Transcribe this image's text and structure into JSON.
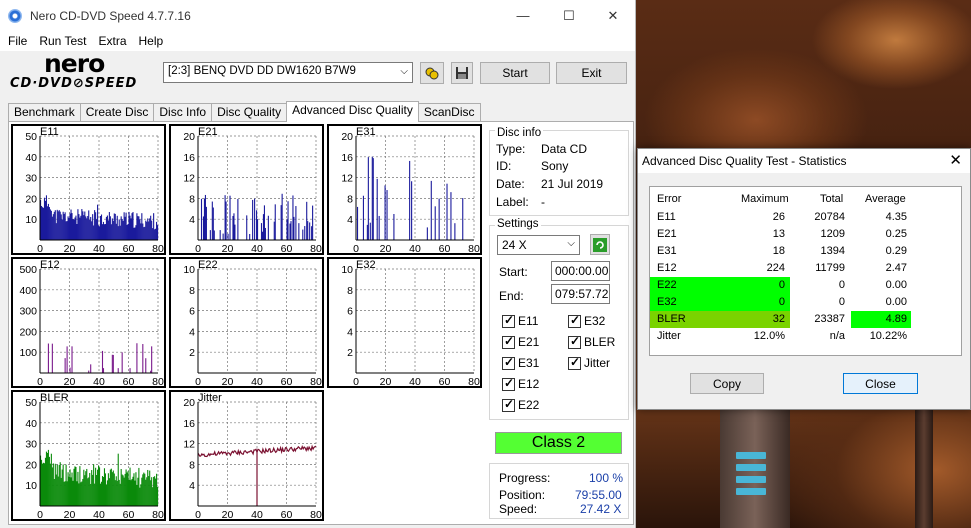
{
  "window": {
    "title": "Nero CD-DVD Speed 4.7.7.16",
    "minimize": "—",
    "maximize": "☐",
    "close": "✕"
  },
  "menu": [
    "File",
    "Run Test",
    "Extra",
    "Help"
  ],
  "logo": {
    "nero": "nero",
    "cddvd": "CD·DVD⊘SPEED"
  },
  "toolbar": {
    "drive": "[2:3]  BENQ DVD DD DW1620 B7W9",
    "start": "Start",
    "exit": "Exit",
    "drive_icon": "drive-swap-icon",
    "save_icon": "floppy-disk-icon"
  },
  "tabs": [
    "Benchmark",
    "Create Disc",
    "Disc Info",
    "Disc Quality",
    "Advanced Disc Quality",
    "ScanDisc"
  ],
  "active_tab": 4,
  "disc_info": {
    "title": "Disc info",
    "type_label": "Type:",
    "type": "Data CD",
    "id_label": "ID:",
    "id": "Sony",
    "date_label": "Date:",
    "date": "21 Jul 2019",
    "label_label": "Label:",
    "label": "-"
  },
  "settings": {
    "title": "Settings",
    "speed": "24 X",
    "start_label": "Start:",
    "start": "000:00.00",
    "end_label": "End:",
    "end": "079:57.72",
    "checks": {
      "e11": "E11",
      "e32": "E32",
      "e21": "E21",
      "bler": "BLER",
      "e31": "E31",
      "jitter": "Jitter",
      "e12": "E12",
      "e22": "E22"
    }
  },
  "class_label": "Class 2",
  "progress": {
    "progress_label": "Progress:",
    "progress": "100 %",
    "position_label": "Position:",
    "position": "79:55.00",
    "speed_label": "Speed:",
    "speed": "27.42 X"
  },
  "chart_data": [
    {
      "type": "bar",
      "title": "E11",
      "xlim": [
        0,
        80
      ],
      "ylim": [
        0,
        50
      ],
      "yticks": [
        10,
        20,
        30,
        40,
        50
      ],
      "xticks": [
        0,
        20,
        40,
        60,
        80
      ],
      "color": "#1a1a9c",
      "max": 26,
      "profile": "e11"
    },
    {
      "type": "bar",
      "title": "E21",
      "xlim": [
        0,
        80
      ],
      "ylim": [
        0,
        20
      ],
      "yticks": [
        4,
        8,
        12,
        16,
        20
      ],
      "xticks": [
        0,
        20,
        40,
        60,
        80
      ],
      "color": "#1a1a9c",
      "max": 13,
      "profile": "e21"
    },
    {
      "type": "bar",
      "title": "E31",
      "xlim": [
        0,
        80
      ],
      "ylim": [
        0,
        20
      ],
      "yticks": [
        4,
        8,
        12,
        16,
        20
      ],
      "xticks": [
        0,
        20,
        40,
        60,
        80
      ],
      "color": "#1a1a9c",
      "max": 18,
      "profile": "e31"
    },
    {
      "type": "bar",
      "title": "E12",
      "xlim": [
        0,
        80
      ],
      "ylim": [
        0,
        500
      ],
      "yticks": [
        100,
        200,
        300,
        400,
        500
      ],
      "xticks": [
        0,
        20,
        40,
        60,
        80
      ],
      "color": "#7a1a8c",
      "max": 224,
      "profile": "e12"
    },
    {
      "type": "bar",
      "title": "E22",
      "xlim": [
        0,
        80
      ],
      "ylim": [
        0,
        10
      ],
      "yticks": [
        2,
        4,
        6,
        8,
        10
      ],
      "xticks": [
        0,
        20,
        40,
        60,
        80
      ],
      "color": "#1a1a9c",
      "max": 0,
      "profile": "zero"
    },
    {
      "type": "bar",
      "title": "E32",
      "xlim": [
        0,
        80
      ],
      "ylim": [
        0,
        10
      ],
      "yticks": [
        2,
        4,
        6,
        8,
        10
      ],
      "xticks": [
        0,
        20,
        40,
        60,
        80
      ],
      "color": "#1a1a9c",
      "max": 0,
      "profile": "zero"
    },
    {
      "type": "bar",
      "title": "BLER",
      "xlim": [
        0,
        80
      ],
      "ylim": [
        0,
        50
      ],
      "yticks": [
        10,
        20,
        30,
        40,
        50
      ],
      "xticks": [
        0,
        20,
        40,
        60,
        80
      ],
      "color": "#0a8a0a",
      "max": 32,
      "profile": "bler"
    },
    {
      "type": "line",
      "title": "Jitter",
      "xlim": [
        0,
        80
      ],
      "ylim": [
        0,
        20
      ],
      "yticks": [
        4,
        8,
        12,
        16,
        20
      ],
      "xticks": [
        0,
        20,
        40,
        60,
        80
      ],
      "color": "#7a1030",
      "profile": "jitter"
    }
  ],
  "stats": {
    "title": "Advanced Disc Quality Test - Statistics",
    "close": "✕",
    "headers": [
      "Error",
      "Maximum",
      "Total",
      "Average"
    ],
    "rows": [
      {
        "name": "E11",
        "max": "26",
        "total": "20784",
        "avg": "4.35"
      },
      {
        "name": "E21",
        "max": "13",
        "total": "1209",
        "avg": "0.25"
      },
      {
        "name": "E31",
        "max": "18",
        "total": "1394",
        "avg": "0.29"
      },
      {
        "name": "E12",
        "max": "224",
        "total": "11799",
        "avg": "2.47"
      },
      {
        "name": "E22",
        "max": "0",
        "total": "0",
        "avg": "0.00"
      },
      {
        "name": "E32",
        "max": "0",
        "total": "0",
        "avg": "0.00"
      },
      {
        "name": "BLER",
        "max": "32",
        "total": "23387",
        "avg": "4.89"
      },
      {
        "name": "Jitter",
        "max": "12.0%",
        "total": "n/a",
        "avg": "10.22%"
      }
    ],
    "copy": "Copy",
    "close_btn": "Close"
  }
}
